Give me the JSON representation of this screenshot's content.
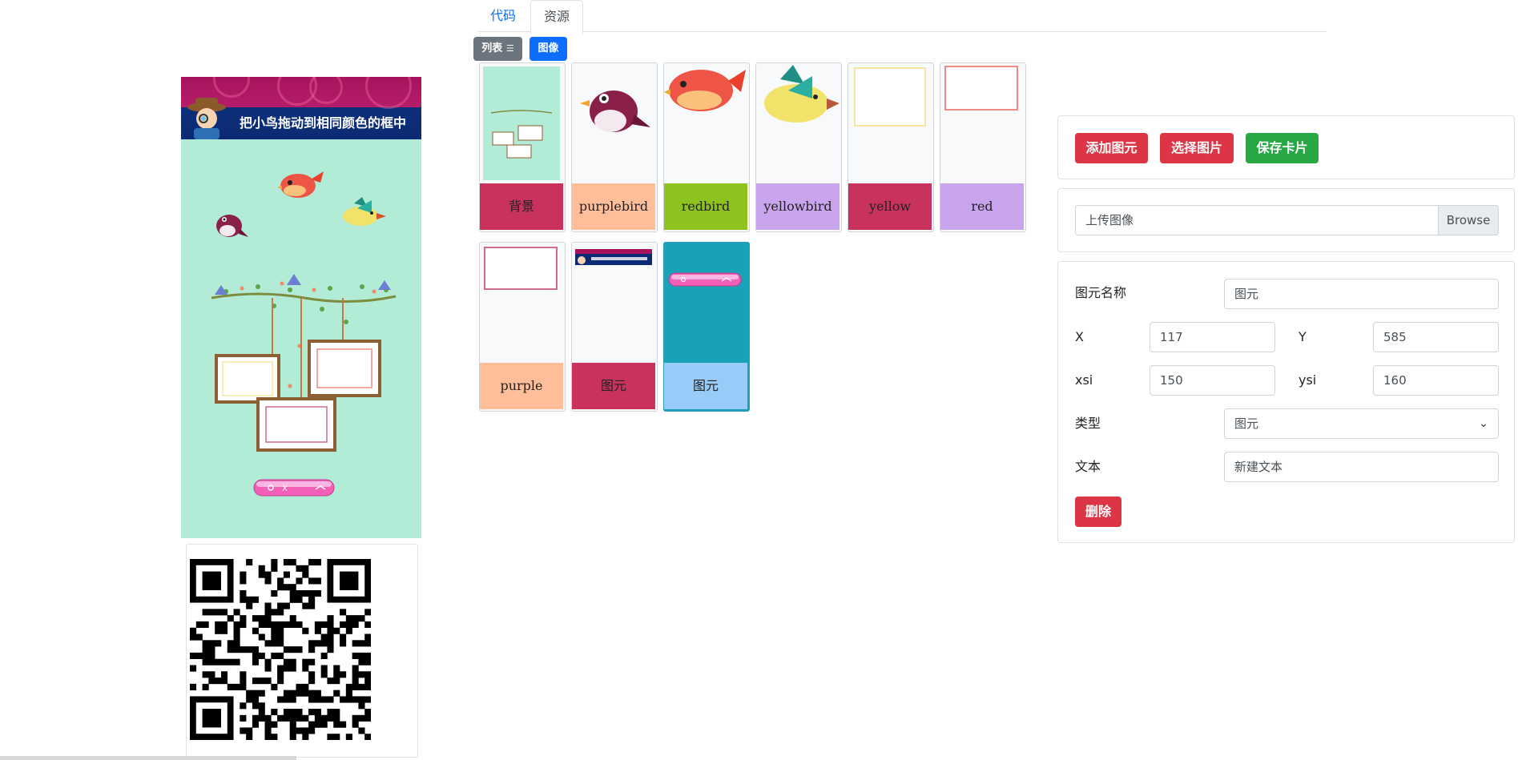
{
  "phone": {
    "title": "把小鸟拖动到相同颜色的框中"
  },
  "tabs": [
    {
      "label": "代码",
      "active": false
    },
    {
      "label": "资源",
      "active": true
    }
  ],
  "toolbar": {
    "list_label": "列表",
    "image_label": "图像"
  },
  "resources": [
    {
      "name": "背景",
      "color": "#c8325c"
    },
    {
      "name": "purplebird",
      "color": "#ffbd99"
    },
    {
      "name": "redbird",
      "color": "#8ec21f"
    },
    {
      "name": "yellowbird",
      "color": "#c8a4ec"
    },
    {
      "name": "yellow",
      "color": "#c8325c"
    },
    {
      "name": "red",
      "color": "#c8a4ec"
    },
    {
      "name": "purple",
      "color": "#ffbd99"
    },
    {
      "name": "图元",
      "color": "#c8325c"
    },
    {
      "name": "图元",
      "color": "#98cbf7",
      "selected": true
    }
  ],
  "actions": {
    "add_element": "添加图元",
    "choose_image": "选择图片",
    "save_card": "保存卡片"
  },
  "upload": {
    "placeholder": "上传图像",
    "browse": "Browse"
  },
  "props": {
    "name_label": "图元名称",
    "name_value": "图元",
    "x_label": "X",
    "x_value": "117",
    "y_label": "Y",
    "y_value": "585",
    "xsi_label": "xsi",
    "xsi_value": "150",
    "ysi_label": "ysi",
    "ysi_value": "160",
    "type_label": "类型",
    "type_value": "图元",
    "text_label": "文本",
    "text_value": "新建文本",
    "delete": "删除"
  },
  "colors": {
    "primary": "#0d6efd",
    "danger": "#dc3545",
    "success": "#28a745",
    "secondary": "#6c757d",
    "canvas_bg": "#b2ebd6"
  }
}
